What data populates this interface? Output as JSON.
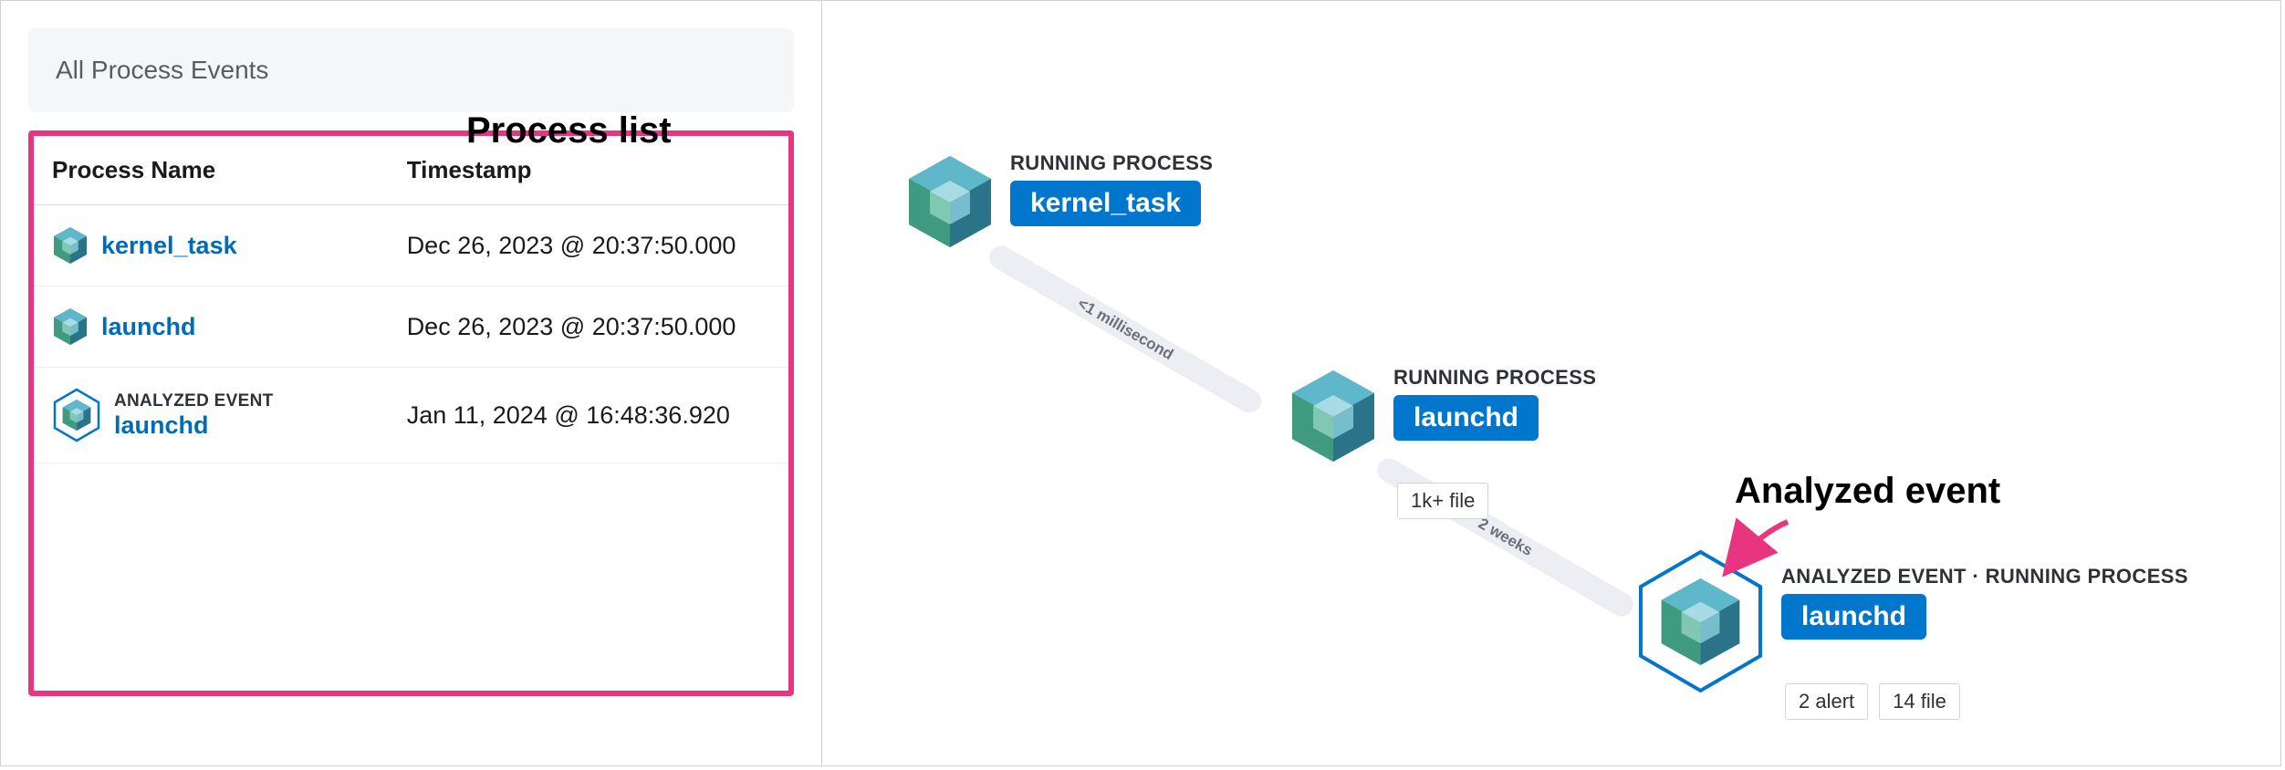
{
  "left": {
    "header": "All Process Events",
    "callout": "Process list",
    "columns": {
      "name": "Process Name",
      "time": "Timestamp"
    },
    "rows": [
      {
        "name": "kernel_task",
        "time": "Dec 26, 2023 @ 20:37:50.000",
        "analyzed": false
      },
      {
        "name": "launchd",
        "time": "Dec 26, 2023 @ 20:37:50.000",
        "analyzed": false
      },
      {
        "name": "launchd",
        "time": "Jan 11, 2024 @ 16:48:36.920",
        "analyzed": true,
        "analyzed_label": "ANALYZED EVENT"
      }
    ]
  },
  "graph": {
    "nodes": [
      {
        "caption": "RUNNING PROCESS",
        "name": "kernel_task",
        "badges": []
      },
      {
        "caption": "RUNNING PROCESS",
        "name": "launchd",
        "badges": [
          "1k+ file"
        ]
      },
      {
        "caption": "ANALYZED EVENT · RUNNING PROCESS",
        "name": "launchd",
        "badges": [
          "2 alert",
          "14 file"
        ],
        "analyzed": true
      }
    ],
    "edges": [
      {
        "label": "<1 millisecond"
      },
      {
        "label": "2 weeks"
      }
    ],
    "callout": "Analyzed event"
  },
  "colors": {
    "accent": "#0077cc",
    "link": "#006bb8",
    "highlight_border": "#e8357f"
  }
}
